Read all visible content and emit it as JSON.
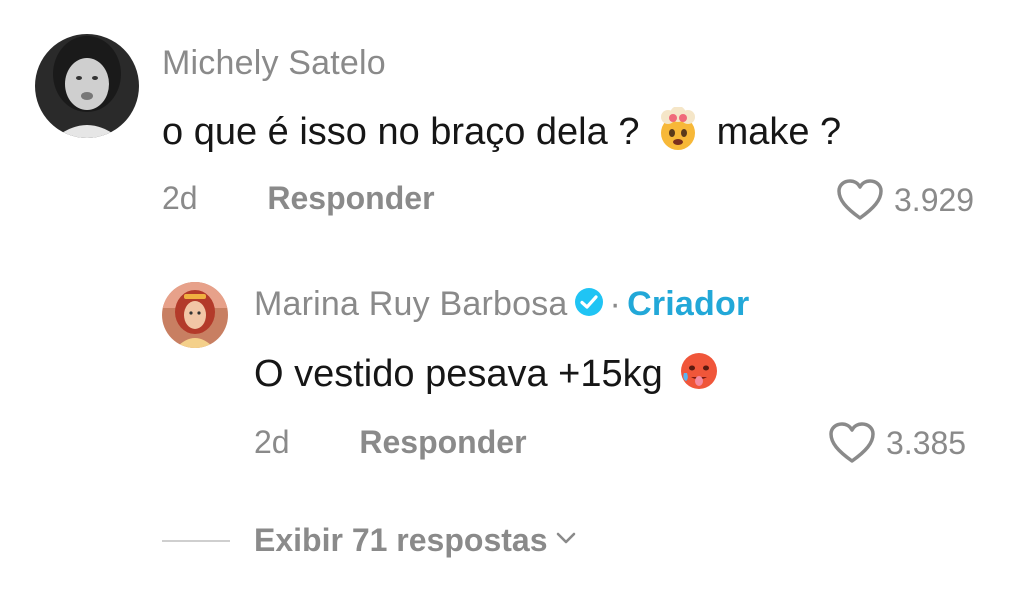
{
  "comment": {
    "author": "Michely Satelo",
    "text_before": "o que é isso no braço dela ?",
    "emoji": "exploding-head-emoji",
    "text_after": "make ?",
    "age": "2d",
    "reply_label": "Responder",
    "likes": "3.929"
  },
  "reply": {
    "author": "Marina Ruy Barbosa",
    "separator": "·",
    "badge": "Criador",
    "text": "O vestido pesava +15kg",
    "emoji": "hot-face-emoji",
    "age": "2d",
    "reply_label": "Responder",
    "likes": "3.385"
  },
  "view_replies": {
    "label": "Exibir 71 respostas"
  },
  "colors": {
    "muted": "#8a8a8a",
    "creator": "#22a8d8",
    "verified": "#20c4f4"
  }
}
